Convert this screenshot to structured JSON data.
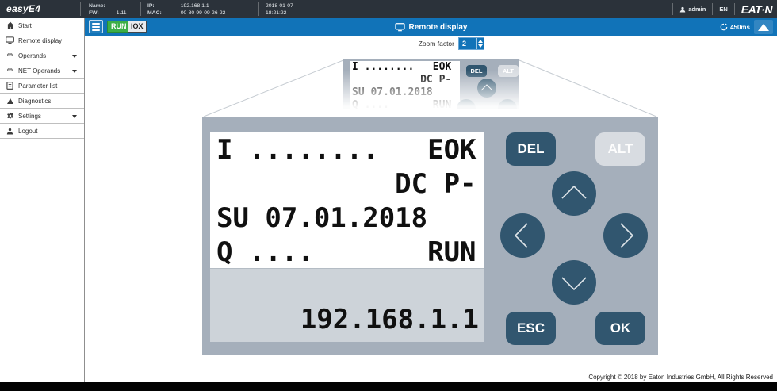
{
  "topbar": {
    "app_logo": "easyE4",
    "brand_logo": "EAT·N",
    "name_label": "Name:",
    "name_value": "—",
    "fw_label": "FW:",
    "fw_value": "1.11",
    "ip_label": "IP:",
    "ip_value": "192.168.1.1",
    "mac_label": "MAC:",
    "mac_value": "00-80-99-09-26-22",
    "date": "2018-01-07",
    "time": "18:21:22",
    "user": "admin",
    "language": "EN"
  },
  "sidebar": {
    "items": [
      {
        "label": "Start"
      },
      {
        "label": "Remote display"
      },
      {
        "label": "Operands"
      },
      {
        "label": "NET Operands"
      },
      {
        "label": "Parameter list"
      },
      {
        "label": "Diagnostics"
      },
      {
        "label": "Settings"
      },
      {
        "label": "Logout"
      }
    ]
  },
  "toolbar": {
    "run_badge": "RUN",
    "iox_badge": "IOX",
    "title": "Remote display",
    "refresh_interval": "450ms"
  },
  "zoom": {
    "label": "Zoom factor",
    "value": "2"
  },
  "display": {
    "lines": [
      "I ........   EOK",
      "           DC P-",
      "SU 07.01.2018",
      "Q ....       RUN"
    ],
    "status_line": "192.168.1.1"
  },
  "keys": {
    "del": "DEL",
    "alt": "ALT",
    "esc": "ESC",
    "ok": "OK"
  },
  "footer": {
    "copyright": "Copyright © 2018 by Eaton Industries GmbH, All Rights Reserved"
  },
  "colors": {
    "accent_blue": "#1173b8",
    "run_green": "#3cae47",
    "panel_gray": "#a5afbb",
    "key_dark": "#31566f",
    "lcd_status_gray": "#cdd3d9",
    "topbar_dark": "#2b323a"
  }
}
